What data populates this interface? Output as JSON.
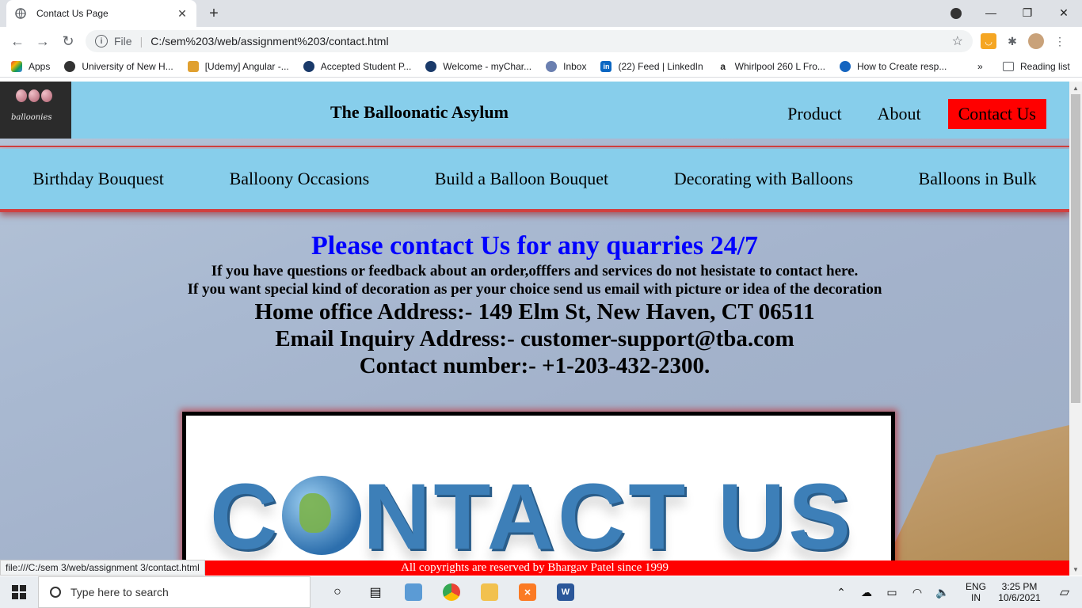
{
  "browser": {
    "tab_title": "Contact Us Page",
    "url_scheme": "File",
    "url": "C:/sem%203/web/assignment%203/contact.html",
    "bookmarks": [
      {
        "label": "Apps",
        "color": "#e8453c"
      },
      {
        "label": "University of New H...",
        "color": "#333333"
      },
      {
        "label": "[Udemy] Angular -...",
        "color": "#e0a030"
      },
      {
        "label": "Accepted Student P...",
        "color": "#1a3a6a"
      },
      {
        "label": "Welcome - myChar...",
        "color": "#1a3a6a"
      },
      {
        "label": "Inbox",
        "color": "#6a7fb0"
      },
      {
        "label": "(22) Feed | LinkedIn",
        "color": "#0a66c2"
      },
      {
        "label": "Whirlpool 260 L Fro...",
        "color": "#222222"
      },
      {
        "label": "How to Create resp...",
        "color": "#1565c0"
      }
    ],
    "more_bookmarks": "»",
    "reading_list": "Reading list",
    "status_url": "file:///C:/sem 3/web/assignment 3/contact.html"
  },
  "site": {
    "title": "The Balloonatic Asylum",
    "logo_text": "balloonies",
    "topnav": [
      "Product",
      "About",
      "Contact Us"
    ],
    "active_nav": "Contact Us",
    "subnav": [
      "Birthday Bouquest",
      "Balloony Occasions",
      "Build a Balloon Bouquet",
      "Decorating with Balloons",
      "Balloons in Bulk"
    ]
  },
  "content": {
    "heading": "Please contact Us for any quarries 24/7",
    "line1": "If you have questions or feedback about an order,offfers and services do not hesistate to contact here.",
    "line2": "If you want special kind of decoration as per your choice send us email with picture or idea of the decoration",
    "address": "Home office Address:- 149 Elm St, New Haven, CT 06511",
    "email": "Email Inquiry Address:- customer-support@tba.com",
    "phone": "Contact number:- +1-203-432-2300.",
    "image_text_a": "C",
    "image_text_b": "NTACT US"
  },
  "footer": "All copyrights are reserved by Bhargav Patel since 1999",
  "taskbar": {
    "search_placeholder": "Type here to search",
    "lang_top": "ENG",
    "lang_bottom": "IN",
    "time": "3:25 PM",
    "date": "10/6/2021"
  },
  "colors": {
    "header_bg": "#87ceeb",
    "active_nav_bg": "#ff0000",
    "heading_color": "#0000ff",
    "footer_bg": "#ff0000"
  }
}
